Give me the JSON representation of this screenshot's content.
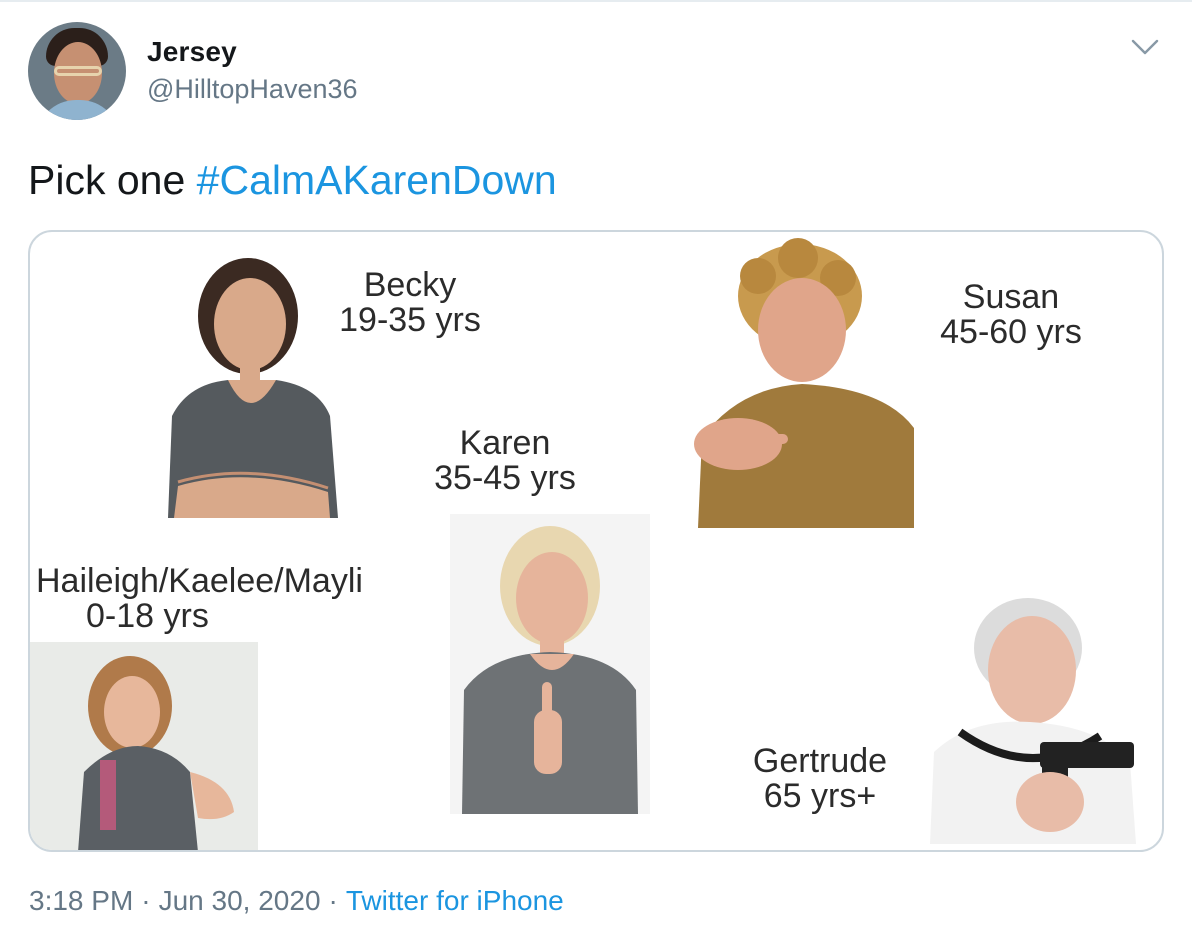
{
  "author": {
    "display_name": "Jersey",
    "handle": "@HilltopHaven36"
  },
  "tweet": {
    "text_prefix": "Pick one ",
    "hashtag": "#CalmAKarenDown"
  },
  "meme": {
    "labels": {
      "becky_name": "Becky",
      "becky_age": "19-35 yrs",
      "susan_name": "Susan",
      "susan_age": "45-60 yrs",
      "karen_name": "Karen",
      "karen_age": "35-45 yrs",
      "haileigh_name": "Haileigh/Kaelee/Mayli",
      "haileigh_age": "0-18 yrs",
      "gertrude_name": "Gertrude",
      "gertrude_age": "65 yrs+"
    }
  },
  "footer": {
    "time": "3:18 PM",
    "date": "Jun 30, 2020",
    "source": "Twitter for iPhone",
    "separator": "·"
  },
  "icons": {
    "caret": "chevron-down-icon"
  },
  "colors": {
    "link": "#1b95e0",
    "secondary_text": "#657786",
    "border": "#ccd6dd"
  }
}
